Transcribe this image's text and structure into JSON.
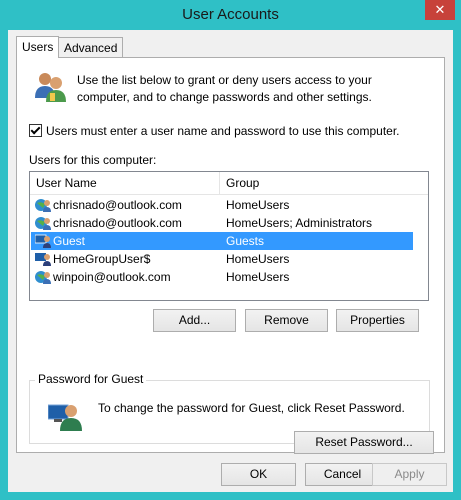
{
  "window": {
    "title": "User Accounts",
    "close_glyph": "✕"
  },
  "tabs": [
    {
      "label": "Users",
      "active": true
    },
    {
      "label": "Advanced",
      "active": false
    }
  ],
  "intro": {
    "text": "Use the list below to grant or deny users access to your computer, and to change passwords and other settings.",
    "icon": "users-icon"
  },
  "require_login": {
    "label": "Users must enter a user name and password to use this computer.",
    "checked": true
  },
  "users_list": {
    "label": "Users for this computer:",
    "columns": [
      "User Name",
      "Group"
    ],
    "rows": [
      {
        "name": "chrisnado@outlook.com",
        "group": "HomeUsers",
        "selected": false
      },
      {
        "name": "chrisnado@outlook.com",
        "group": "HomeUsers; Administrators",
        "selected": false
      },
      {
        "name": "Guest",
        "group": "Guests",
        "selected": true
      },
      {
        "name": "HomeGroupUser$",
        "group": "HomeUsers",
        "selected": false
      },
      {
        "name": "winpoin@outlook.com",
        "group": "HomeUsers",
        "selected": false
      }
    ]
  },
  "actions": {
    "add": "Add...",
    "remove": "Remove",
    "properties": "Properties"
  },
  "password_group": {
    "title": "Password for Guest",
    "text": "To change the password for Guest, click Reset Password.",
    "reset": "Reset Password..."
  },
  "footer": {
    "ok": "OK",
    "cancel": "Cancel",
    "apply": "Apply"
  },
  "colors": {
    "selection": "#3399ff",
    "titlebar": "#2fc0c6",
    "close": "#c7423a"
  }
}
